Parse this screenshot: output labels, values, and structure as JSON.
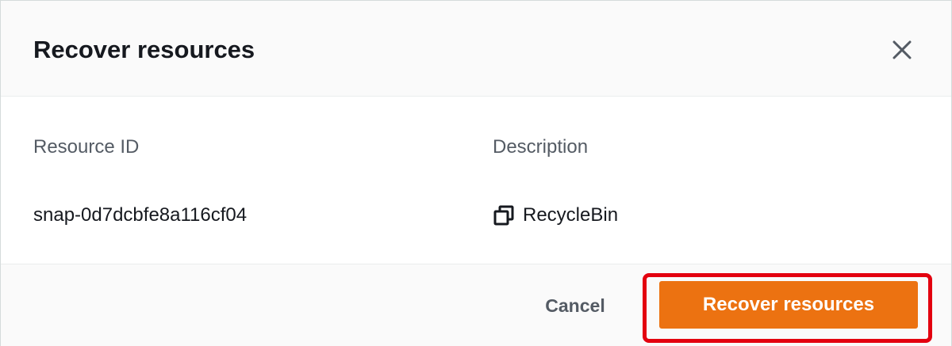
{
  "dialog": {
    "title": "Recover resources",
    "close_icon": "close-icon"
  },
  "table": {
    "columns": [
      "Resource ID",
      "Description"
    ],
    "rows": [
      {
        "resource_id": "snap-0d7dcbfe8a116cf04",
        "description": "RecycleBin",
        "description_icon": "copy-icon"
      }
    ]
  },
  "footer": {
    "cancel_label": "Cancel",
    "primary_label": "Recover resources"
  },
  "colors": {
    "primary": "#ec7211",
    "highlight": "#e3000f",
    "text": "#16191f",
    "muted_text": "#545b64",
    "header_bg": "#fafafa"
  }
}
